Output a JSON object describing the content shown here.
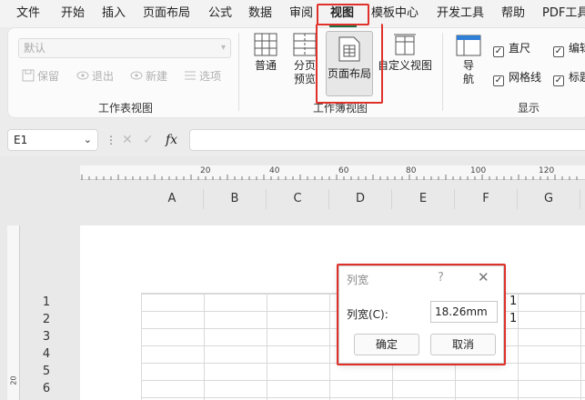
{
  "menu": {
    "items": [
      "文件",
      "开始",
      "插入",
      "页面布局",
      "公式",
      "数据",
      "审阅",
      "视图",
      "模板中心",
      "开发工具",
      "帮助",
      "PDF工具"
    ],
    "active": "视图"
  },
  "ribbon": {
    "workbook_group": {
      "style_combo": "默认",
      "buttons": [
        "保留",
        "退出",
        "新建",
        "选项"
      ],
      "label": "工作表视图"
    },
    "views_group": {
      "buttons": [
        {
          "label": "普通"
        },
        {
          "label_line1": "分页",
          "label_line2": "预览"
        },
        {
          "label": "页面布局"
        },
        {
          "label": "自定义视图"
        }
      ],
      "label": "工作簿视图"
    },
    "show_group": {
      "nav_label_line1": "导",
      "nav_label_line2": "航",
      "checks": [
        {
          "label": "直尺",
          "checked": true
        },
        {
          "label": "网格线",
          "checked": true
        },
        {
          "label": "编辑",
          "checked": true
        },
        {
          "label": "标题",
          "checked": true
        }
      ],
      "label": "显示"
    }
  },
  "formula_bar": {
    "name_box": "E1",
    "cancel_symbol": "✕",
    "enter_symbol": "✓",
    "fx_symbol": "fx",
    "value": ""
  },
  "sheet": {
    "ruler_ticks": [
      "20",
      "40",
      "60",
      "80",
      "100",
      "120"
    ],
    "columns": [
      "A",
      "B",
      "C",
      "D",
      "E",
      "F",
      "G"
    ],
    "rows": [
      "1",
      "2",
      "3",
      "4",
      "5",
      "6"
    ],
    "vertical_ruler_label": "20",
    "edge_marks": [
      "1",
      "1"
    ]
  },
  "dialog": {
    "title": "列宽",
    "help": "?",
    "close": "✕",
    "field_label": "列宽(C):",
    "field_value": "18.26mm",
    "ok": "确定",
    "cancel": "取消"
  },
  "colors": {
    "accent": "#1e7145",
    "highlight": "#e0302a",
    "selected_bg": "#e7e7e7"
  }
}
